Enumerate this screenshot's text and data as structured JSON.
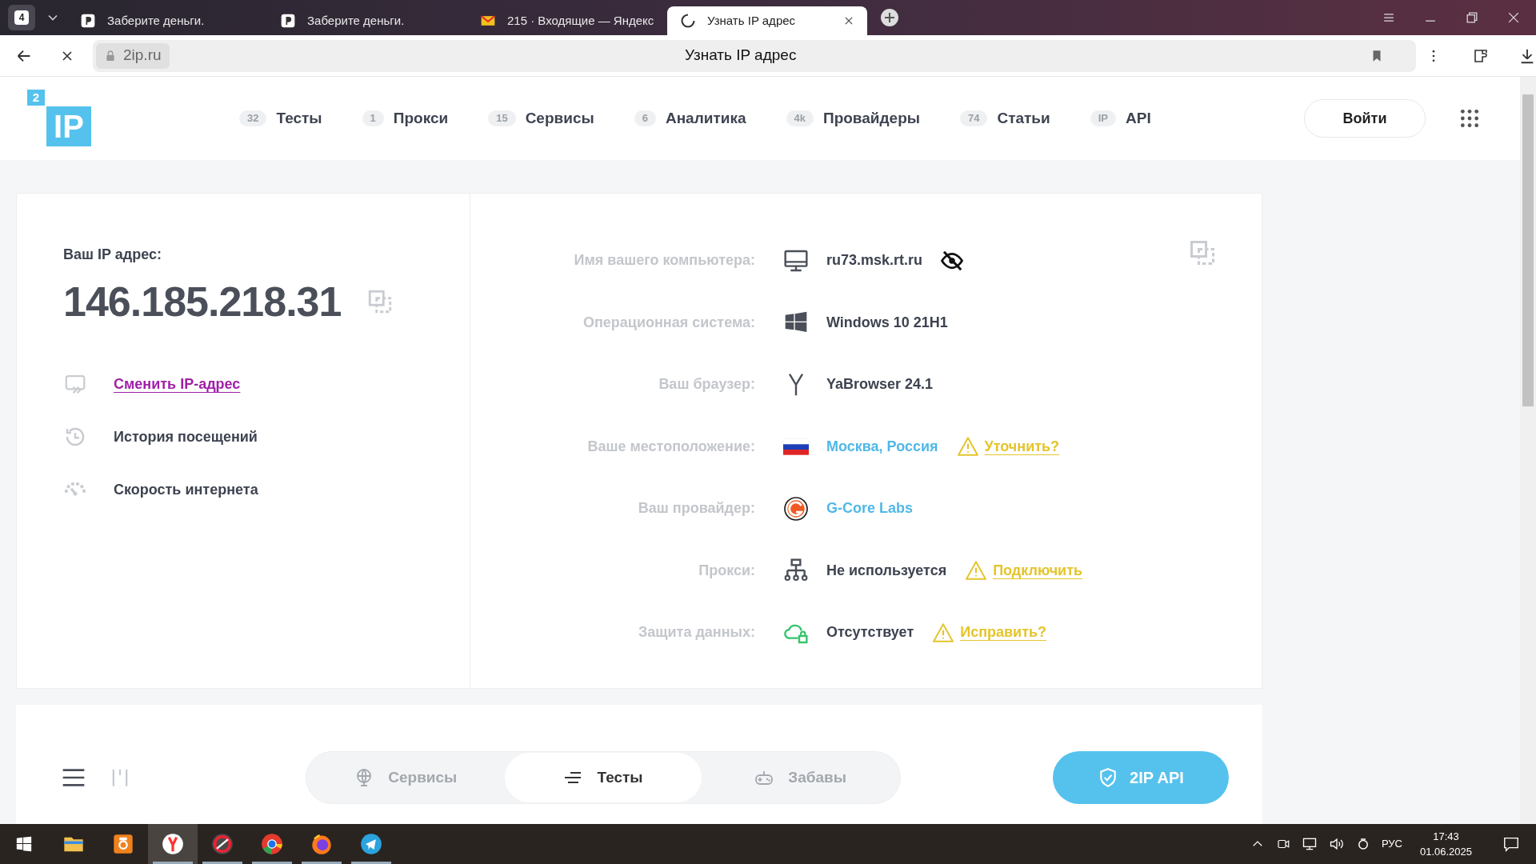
{
  "browser": {
    "tab_count": "4",
    "tabs": [
      {
        "title": "Заберите деньги.",
        "selected": false
      },
      {
        "title": "Заберите деньги.",
        "selected": false
      },
      {
        "title": "215 · Входящие — Яндекс",
        "selected": false
      },
      {
        "title": "Узнать IP адрес",
        "selected": true
      }
    ],
    "address": {
      "domain": "2ip.ru",
      "page_title": "Узнать IP адрес"
    }
  },
  "header": {
    "logo_badge": "2",
    "logo_text": "IP",
    "nav": [
      {
        "count": "32",
        "label": "Тесты"
      },
      {
        "count": "1",
        "label": "Прокси"
      },
      {
        "count": "15",
        "label": "Сервисы"
      },
      {
        "count": "6",
        "label": "Аналитика"
      },
      {
        "count": "4k",
        "label": "Провайдеры"
      },
      {
        "count": "74",
        "label": "Статьи"
      },
      {
        "count": "IP",
        "label": "API"
      }
    ],
    "login": "Войти"
  },
  "ip_panel": {
    "label": "Ваш IP адрес:",
    "ip": "146.185.218.31",
    "links": [
      {
        "label": "Сменить IP-адрес",
        "kind": "visited"
      },
      {
        "label": "История посещений",
        "kind": "plain"
      },
      {
        "label": "Скорость интернета",
        "kind": "plain"
      }
    ]
  },
  "details": [
    {
      "label": "Имя вашего компьютера:",
      "value": "ru73.msk.rt.ru",
      "kind": "text",
      "hidden": true
    },
    {
      "label": "Операционная система:",
      "value": "Windows 10 21H1",
      "kind": "text"
    },
    {
      "label": "Ваш браузер:",
      "value": "YaBrowser 24.1",
      "kind": "text"
    },
    {
      "label": "Ваше местоположение:",
      "value": "Москва, Россия",
      "kind": "link",
      "action": "Уточнить?"
    },
    {
      "label": "Ваш провайдер:",
      "value": "G-Core Labs",
      "kind": "link"
    },
    {
      "label": "Прокси:",
      "value": "Не используется",
      "kind": "text",
      "action": "Подключить"
    },
    {
      "label": "Защита данных:",
      "value": "Отсутствует",
      "kind": "text",
      "action": "Исправить?"
    }
  ],
  "toolbar": {
    "segments": [
      {
        "label": "Сервисы",
        "selected": false
      },
      {
        "label": "Тесты",
        "selected": true
      },
      {
        "label": "Забавы",
        "selected": false
      }
    ],
    "api_button": "2IP API"
  },
  "taskbar": {
    "apps": [
      {
        "running": false,
        "selected": false
      },
      {
        "running": false,
        "selected": false
      },
      {
        "running": true,
        "selected": true
      },
      {
        "running": true,
        "selected": false
      },
      {
        "running": true,
        "selected": false
      },
      {
        "running": true,
        "selected": false
      },
      {
        "running": true,
        "selected": false
      }
    ],
    "language": "РУС",
    "time": "17:43",
    "date": "01.06.2025"
  }
}
